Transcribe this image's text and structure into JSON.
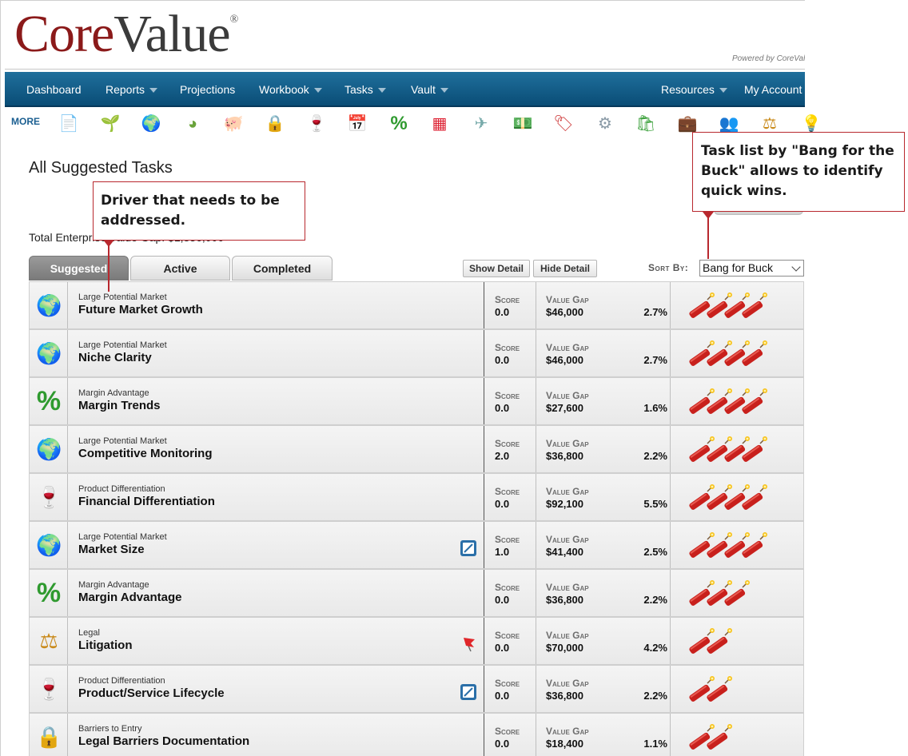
{
  "brand": {
    "core": "Core",
    "value": "Value",
    "reg": "®",
    "powered": "Powered by CoreValue"
  },
  "nav": {
    "left": [
      {
        "label": "Dashboard",
        "caret": false
      },
      {
        "label": "Reports",
        "caret": true
      },
      {
        "label": "Projections",
        "caret": false
      },
      {
        "label": "Workbook",
        "caret": true
      },
      {
        "label": "Tasks",
        "caret": true
      },
      {
        "label": "Vault",
        "caret": true
      }
    ],
    "right": [
      {
        "label": "Resources",
        "caret": true
      },
      {
        "label": "My Account",
        "caret": false
      }
    ]
  },
  "icon_strip": {
    "more_label": "MORE",
    "icons": [
      {
        "name": "document-icon",
        "glyph": "📄",
        "color": "#b33"
      },
      {
        "name": "sprout-icon",
        "glyph": "🌱",
        "color": "#3a8a2a"
      },
      {
        "name": "globe-icon",
        "glyph": "🌍",
        "color": "#1e7ab8"
      },
      {
        "name": "pie-chart-icon",
        "glyph": "◕",
        "color": "#6aa33a"
      },
      {
        "name": "piggy-bank-icon",
        "glyph": "🐖",
        "color": "#e38aa6"
      },
      {
        "name": "padlock-icon",
        "glyph": "🔒",
        "color": "#b48a2a"
      },
      {
        "name": "bottles-icon",
        "glyph": "🍷",
        "color": "#7a1a1a"
      },
      {
        "name": "calendar-icon",
        "glyph": "📅",
        "color": "#c22"
      },
      {
        "name": "percent-icon",
        "glyph": "%",
        "color": "#2f9a2f"
      },
      {
        "name": "color-blocks-icon",
        "glyph": "▦",
        "color": "#d23"
      },
      {
        "name": "airplane-icon",
        "glyph": "✈",
        "color": "#7aa"
      },
      {
        "name": "money-icon",
        "glyph": "💵",
        "color": "#6a9a2a"
      },
      {
        "name": "price-tag-icon",
        "glyph": "🏷",
        "color": "#c33"
      },
      {
        "name": "gear-icon",
        "glyph": "⚙",
        "color": "#8a9aa6"
      },
      {
        "name": "shopping-bag-icon",
        "glyph": "🛍",
        "color": "#3aa03a"
      },
      {
        "name": "briefcase-icon",
        "glyph": "💼",
        "color": "#7a4a1a"
      },
      {
        "name": "people-icon",
        "glyph": "👥",
        "color": "#b55"
      },
      {
        "name": "scales-icon",
        "glyph": "⚖",
        "color": "#c98a1a"
      },
      {
        "name": "lightbulb-icon",
        "glyph": "💡",
        "color": "#e0b000"
      }
    ]
  },
  "page": {
    "title": "All Suggested Tasks",
    "gap_text": "Total Enterprise Value Gap: $1,836,000"
  },
  "tabs": [
    {
      "label": "Suggested",
      "active": true
    },
    {
      "label": "Active",
      "active": false
    },
    {
      "label": "Completed",
      "active": false
    }
  ],
  "controls": {
    "show_detail": "Show Detail",
    "hide_detail": "Hide Detail",
    "sort_by_label": "Sort By:",
    "sort_value": "Bang for Buck"
  },
  "row_labels": {
    "score": "Score",
    "value_gap": "Value Gap"
  },
  "tasks": [
    {
      "category": "Large Potential Market",
      "name": "Future Market Growth",
      "icon": "globe-icon",
      "glyph": "🌍",
      "score": "0.0",
      "gap": "$46,000",
      "pct": "2.7%",
      "bang": 4,
      "marker": ""
    },
    {
      "category": "Large Potential Market",
      "name": "Niche Clarity",
      "icon": "globe-icon",
      "glyph": "🌍",
      "score": "0.0",
      "gap": "$46,000",
      "pct": "2.7%",
      "bang": 4,
      "marker": ""
    },
    {
      "category": "Margin Advantage",
      "name": "Margin Trends",
      "icon": "percent-icon",
      "glyph": "%",
      "score": "0.0",
      "gap": "$27,600",
      "pct": "1.6%",
      "bang": 4,
      "marker": ""
    },
    {
      "category": "Large Potential Market",
      "name": "Competitive Monitoring",
      "icon": "globe-icon",
      "glyph": "🌍",
      "score": "2.0",
      "gap": "$36,800",
      "pct": "2.2%",
      "bang": 4,
      "marker": ""
    },
    {
      "category": "Product Differentiation",
      "name": "Financial Differentiation",
      "icon": "bottles-icon",
      "glyph": "🍷",
      "score": "0.0",
      "gap": "$92,100",
      "pct": "5.5%",
      "bang": 4,
      "marker": ""
    },
    {
      "category": "Large Potential Market",
      "name": "Market Size",
      "icon": "globe-icon",
      "glyph": "🌍",
      "score": "1.0",
      "gap": "$41,400",
      "pct": "2.5%",
      "bang": 4,
      "marker": "note"
    },
    {
      "category": "Margin Advantage",
      "name": "Margin Advantage",
      "icon": "percent-icon",
      "glyph": "%",
      "score": "0.0",
      "gap": "$36,800",
      "pct": "2.2%",
      "bang": 3,
      "marker": ""
    },
    {
      "category": "Legal",
      "name": "Litigation",
      "icon": "scales-icon",
      "glyph": "⚖",
      "score": "0.0",
      "gap": "$70,000",
      "pct": "4.2%",
      "bang": 2,
      "marker": "flag"
    },
    {
      "category": "Product Differentiation",
      "name": "Product/Service Lifecycle",
      "icon": "bottles-icon",
      "glyph": "🍷",
      "score": "0.0",
      "gap": "$36,800",
      "pct": "2.2%",
      "bang": 2,
      "marker": "note"
    },
    {
      "category": "Barriers to Entry",
      "name": "Legal Barriers Documentation",
      "icon": "padlock-icon",
      "glyph": "🔒",
      "score": "0.0",
      "gap": "$18,400",
      "pct": "1.1%",
      "bang": 2,
      "marker": ""
    }
  ],
  "callouts": {
    "left": "Driver that needs to be addressed.",
    "right": "Task list by \"Bang for the Buck\" allows to identify quick wins."
  }
}
